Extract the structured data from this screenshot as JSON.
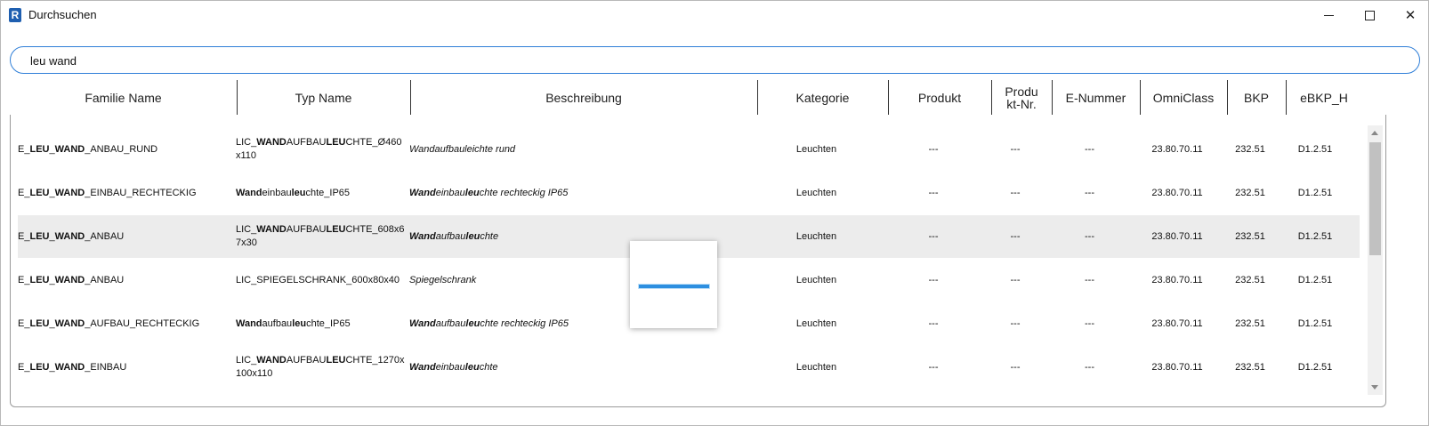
{
  "window": {
    "title": "Durchsuchen",
    "app_icon_letter": "R"
  },
  "search": {
    "value": "leu wand",
    "placeholder": ""
  },
  "columns": [
    "Familie Name",
    "Typ Name",
    "Beschreibung",
    "Kategorie",
    "Produkt",
    "Produkt-Nr.",
    "E-Nummer",
    "OmniClass",
    "BKP",
    "eBKP_H"
  ],
  "rows": [
    {
      "family": [
        [
          "E_",
          false
        ],
        [
          "LEU",
          true
        ],
        [
          "_",
          false
        ],
        [
          "WAND",
          true
        ],
        [
          "_ANBAU_RUND",
          false
        ]
      ],
      "type": [
        [
          "LIC_",
          false
        ],
        [
          "WAND",
          true
        ],
        [
          "AUFBAU",
          false
        ],
        [
          "LEU",
          true
        ],
        [
          "CHTE_Ø460 x110",
          false
        ]
      ],
      "desc": [
        [
          "Wandaufbauleichte rund",
          false
        ]
      ],
      "kategorie": "Leuchten",
      "produkt": "---",
      "produkt_nr": "---",
      "e_nummer": "---",
      "omniclass": "23.80.70.11",
      "bkp": "232.51",
      "ebkp": "D1.2.51"
    },
    {
      "family": [
        [
          "E_",
          false
        ],
        [
          "LEU",
          true
        ],
        [
          "_",
          false
        ],
        [
          "WAND",
          true
        ],
        [
          "_EINBAU_RECHTECKIG",
          false
        ]
      ],
      "type": [
        [
          "Wand",
          true
        ],
        [
          "einbau",
          false
        ],
        [
          "leu",
          true
        ],
        [
          "chte_IP65",
          false
        ]
      ],
      "desc": [
        [
          "Wand",
          true
        ],
        [
          "einbau",
          false
        ],
        [
          "leu",
          true
        ],
        [
          "chte rechteckig IP65",
          false
        ]
      ],
      "kategorie": "Leuchten",
      "produkt": "---",
      "produkt_nr": "---",
      "e_nummer": "---",
      "omniclass": "23.80.70.11",
      "bkp": "232.51",
      "ebkp": "D1.2.51"
    },
    {
      "family": [
        [
          "E_",
          false
        ],
        [
          "LEU",
          true
        ],
        [
          "_",
          false
        ],
        [
          "WAND",
          true
        ],
        [
          "_ANBAU",
          false
        ]
      ],
      "type": [
        [
          "LIC_",
          false
        ],
        [
          "WAND",
          true
        ],
        [
          "AUFBAU",
          false
        ],
        [
          "LEU",
          true
        ],
        [
          "CHTE_608x6 7x30",
          false
        ]
      ],
      "desc": [
        [
          "Wand",
          true
        ],
        [
          "aufbau",
          false
        ],
        [
          "leu",
          true
        ],
        [
          "chte",
          false
        ]
      ],
      "kategorie": "Leuchten",
      "produkt": "---",
      "produkt_nr": "---",
      "e_nummer": "---",
      "omniclass": "23.80.70.11",
      "bkp": "232.51",
      "ebkp": "D1.2.51",
      "selected": true
    },
    {
      "family": [
        [
          "E_",
          false
        ],
        [
          "LEU",
          true
        ],
        [
          "_",
          false
        ],
        [
          "WAND",
          true
        ],
        [
          "_ANBAU",
          false
        ]
      ],
      "type": [
        [
          "LIC_SPIEGELSCHRANK_600x80x40",
          false
        ]
      ],
      "desc": [
        [
          "Spiegelschrank",
          false
        ]
      ],
      "kategorie": "Leuchten",
      "produkt": "---",
      "produkt_nr": "---",
      "e_nummer": "---",
      "omniclass": "23.80.70.11",
      "bkp": "232.51",
      "ebkp": "D1.2.51"
    },
    {
      "family": [
        [
          "E_",
          false
        ],
        [
          "LEU",
          true
        ],
        [
          "_",
          false
        ],
        [
          "WAND",
          true
        ],
        [
          "_AUFBAU_RECHTECKIG",
          false
        ]
      ],
      "type": [
        [
          "Wand",
          true
        ],
        [
          "aufbau",
          false
        ],
        [
          "leu",
          true
        ],
        [
          "chte_IP65",
          false
        ]
      ],
      "desc": [
        [
          "Wand",
          true
        ],
        [
          "aufbau",
          false
        ],
        [
          "leu",
          true
        ],
        [
          "chte rechteckig IP65",
          false
        ]
      ],
      "kategorie": "Leuchten",
      "produkt": "---",
      "produkt_nr": "---",
      "e_nummer": "---",
      "omniclass": "23.80.70.11",
      "bkp": "232.51",
      "ebkp": "D1.2.51"
    },
    {
      "family": [
        [
          "E_",
          false
        ],
        [
          "LEU",
          true
        ],
        [
          "_",
          false
        ],
        [
          "WAND",
          true
        ],
        [
          "_EINBAU",
          false
        ]
      ],
      "type": [
        [
          "LIC_",
          false
        ],
        [
          "WAND",
          true
        ],
        [
          "AUFBAU",
          false
        ],
        [
          "LEU",
          true
        ],
        [
          "CHTE_1270x 100x110",
          false
        ]
      ],
      "desc": [
        [
          "Wand",
          true
        ],
        [
          "einbau",
          false
        ],
        [
          "leu",
          true
        ],
        [
          "chte",
          false
        ]
      ],
      "kategorie": "Leuchten",
      "produkt": "---",
      "produkt_nr": "---",
      "e_nummer": "---",
      "omniclass": "23.80.70.11",
      "bkp": "232.51",
      "ebkp": "D1.2.51"
    }
  ],
  "colors": {
    "accent": "#2f7fd8",
    "row_highlight": "#ececec",
    "progress": "#2d8fe0"
  },
  "icons": {
    "app": "revit-icon",
    "minimize": "minimize-icon",
    "maximize": "maximize-icon",
    "close": "close-icon"
  }
}
